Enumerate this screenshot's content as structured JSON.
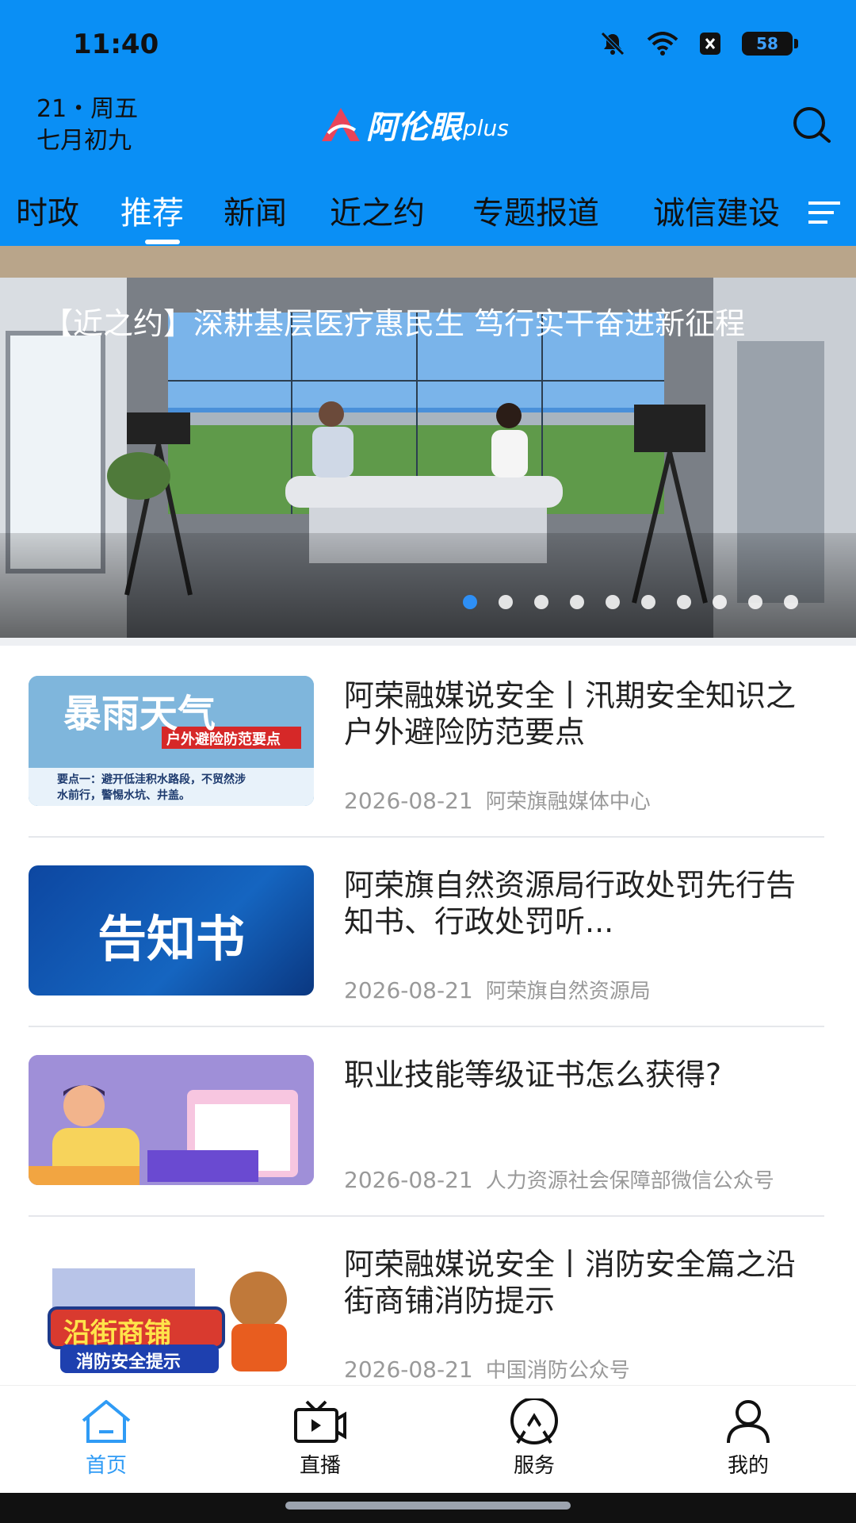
{
  "status_bar": {
    "time": "11:40",
    "battery": "58"
  },
  "header": {
    "date_line1": "21・周五",
    "date_line2": "七月初九",
    "logo_text": "阿伦眼",
    "logo_sub": "plus"
  },
  "tabs": [
    "时政",
    "推荐",
    "新闻",
    "近之约",
    "专题报道",
    "诚信建设"
  ],
  "active_tab": "推荐",
  "banner": {
    "title": "【近之约】深耕基层医疗惠民生 笃行实干奋进新征程",
    "slide_count": 10,
    "active_index": 0
  },
  "news": [
    {
      "title": "阿荣融媒说安全丨汛期安全知识之户外避险防范要点",
      "date": "2026-08-21",
      "source": "阿荣旗融媒体中心",
      "thumb": {
        "heading": "暴雨天气",
        "tag": "户外避险防范要点",
        "line1": "要点一：避开低洼积水路段，不贸然涉",
        "line2": "水前行，警惕水坑、井盖。"
      }
    },
    {
      "title": "阿荣旗自然资源局行政处罚先行告知书、行政处罚听...",
      "date": "2026-08-21",
      "source": "阿荣旗自然资源局",
      "thumb": {
        "heading": "告知书"
      }
    },
    {
      "title": "职业技能等级证书怎么获得?",
      "date": "2026-08-21",
      "source": "人力资源社会保障部微信公众号",
      "thumb": {}
    },
    {
      "title": "阿荣融媒说安全丨消防安全篇之沿街商铺消防提示",
      "date": "2026-08-21",
      "source": "中国消防公众号",
      "thumb": {
        "heading": "沿街商铺",
        "tag": "消防安全提示"
      }
    }
  ],
  "bottom_nav": [
    {
      "label": "首页",
      "icon": "home-icon",
      "active": true
    },
    {
      "label": "直播",
      "icon": "tv-icon",
      "active": false
    },
    {
      "label": "服务",
      "icon": "service-icon",
      "active": false
    },
    {
      "label": "我的",
      "icon": "user-icon",
      "active": false
    }
  ],
  "colors": {
    "primary": "#0a8ff5",
    "nav_active": "#2f9bf5",
    "text": "#222222",
    "meta": "#999999"
  }
}
